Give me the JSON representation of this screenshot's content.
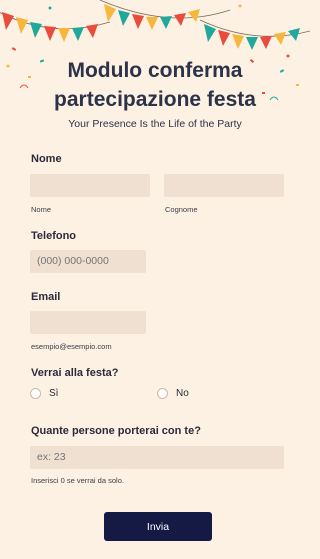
{
  "header": {
    "title": "Modulo conferma partecipazione festa",
    "subtitle": "Your Presence Is the Life of the Party"
  },
  "name_section": {
    "label": "Nome",
    "first_sublabel": "Nome",
    "last_sublabel": "Cognome",
    "first_value": "",
    "last_value": ""
  },
  "phone_section": {
    "label": "Telefono",
    "placeholder": "(000) 000-0000"
  },
  "email_section": {
    "label": "Email",
    "hint": "esempio@esempio.com",
    "value": ""
  },
  "attendance_section": {
    "label": "Verrai alla festa?",
    "options": [
      "Sì",
      "No"
    ]
  },
  "guests_section": {
    "label": "Quante persone porterai con te?",
    "placeholder": "ex: 23",
    "hint": "Inserisci 0 se verrai da solo."
  },
  "submit_label": "Invia",
  "colors": {
    "background": "#fdf1e3",
    "field": "#efe0d2",
    "title": "#2c3349",
    "button": "#141a44"
  }
}
